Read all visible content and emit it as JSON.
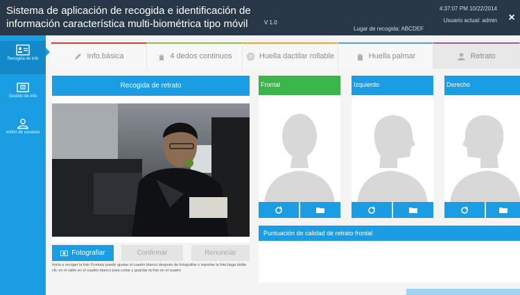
{
  "header": {
    "title": "Sistema de aplicación de recogida e identificación de información característica multi-biométrica tipo móvil",
    "version": "V 1.0",
    "place": "Lugar de recogida: ABCDEF",
    "datetime": "4:37:07 PM 10/22/2014",
    "user": "Usuario actual: admin",
    "close": "×"
  },
  "sidebar": {
    "items": [
      {
        "label": "Recogida de info",
        "icon": "id-card-icon"
      },
      {
        "label": "Gestión de info",
        "icon": "folder-icon"
      },
      {
        "label": "estión de usuarios",
        "icon": "user-icon"
      }
    ]
  },
  "tabs": [
    {
      "label": "Info.básica",
      "accent": "#e53935",
      "icon": "pencil-icon"
    },
    {
      "label": "4 dedos continuos",
      "accent": "#8bc34a",
      "icon": "hand-icon"
    },
    {
      "label": "Huella dactilar rollable",
      "accent": "#f5a623",
      "icon": "fingerprint-icon"
    },
    {
      "label": "Huella palmar",
      "accent": "#4fa3e0",
      "icon": "palm-icon"
    },
    {
      "label": "Retrato",
      "accent": "#9b59b6",
      "icon": "person-icon"
    }
  ],
  "left": {
    "header": "Recogida de retrato",
    "buttons": {
      "capture": "Fotografiar",
      "confirm": "Confirmar",
      "cancel": "Renunciar"
    },
    "help": "Inicia a recoger la foto Frontaly puede ajustar el cuadro blanco después de fotografiar o importar la foto,haga doble clic en el ratón en el cuadro blanco para cortar y guardar la foto en el cuadro"
  },
  "cards": [
    {
      "label": "Frontal",
      "color": "#39b54a"
    },
    {
      "label": "Izquierdo",
      "color": "#1a9de2"
    },
    {
      "label": "Derecho",
      "color": "#1a9de2"
    }
  ],
  "quality": {
    "label": "Puntuación de calidad de retrato frontal"
  },
  "colors": {
    "accent": "#1a9de2",
    "header": "#283848",
    "green": "#39b54a"
  }
}
